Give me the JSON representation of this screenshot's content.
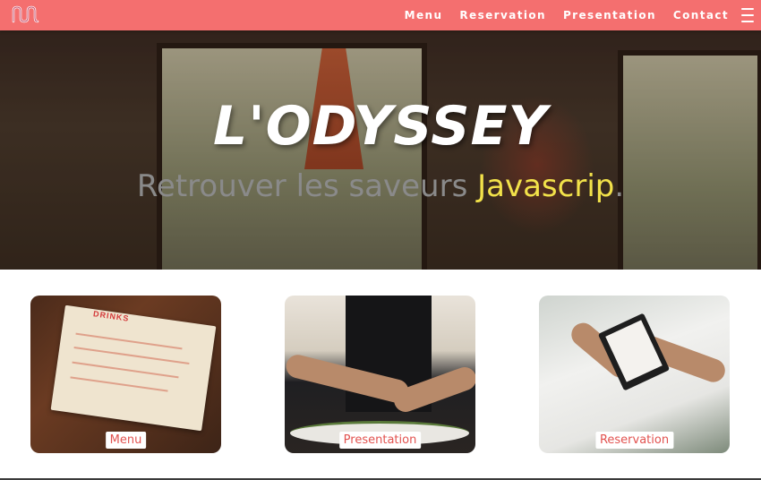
{
  "navbar": {
    "background": "#f46f6f",
    "logo_icon": "wave-logo-icon",
    "links": [
      {
        "label": "Menu"
      },
      {
        "label": "Reservation"
      },
      {
        "label": "Presentation"
      },
      {
        "label": "Contact"
      }
    ],
    "menu_icon": "hamburger-icon"
  },
  "hero": {
    "title": "L'ODYSSEY",
    "subtitle_prefix": "Retrouver les saveurs",
    "subtitle_accent": "Javascrip",
    "subtitle_suffix": ".",
    "accent_color": "#f2e24a"
  },
  "cards": [
    {
      "label": "Menu",
      "label_color": "#e2524f"
    },
    {
      "label": "Presentation",
      "label_color": "#e2524f"
    },
    {
      "label": "Reservation",
      "label_color": "#e2524f"
    }
  ],
  "menu_card_paper_title": "DRINKS"
}
